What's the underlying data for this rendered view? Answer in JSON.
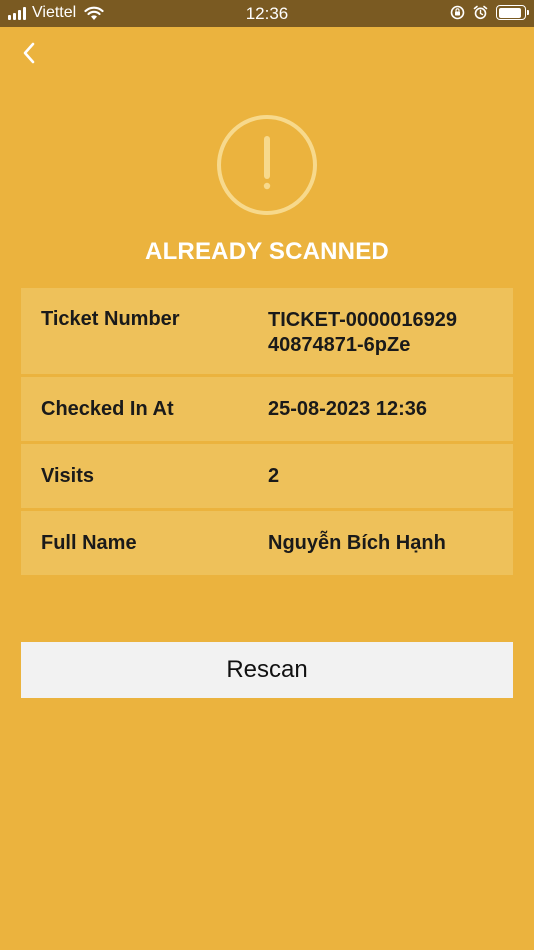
{
  "status_bar": {
    "carrier": "Viettel",
    "time": "12:36"
  },
  "result": {
    "title": "ALREADY SCANNED",
    "status_color": "#ebb33e"
  },
  "ticket_info": [
    {
      "label": "Ticket Number",
      "value": "TICKET-0000016929\n40874871-6pZe"
    },
    {
      "label": "Checked In At",
      "value": "25-08-2023 12:36"
    },
    {
      "label": "Visits",
      "value": "2"
    },
    {
      "label": "Full Name",
      "value": "Nguyễn Bích Hạnh"
    }
  ],
  "actions": {
    "rescan_label": "Rescan"
  },
  "icons": {
    "back": "chevron-left-icon",
    "status": "exclamation-circle-icon"
  }
}
